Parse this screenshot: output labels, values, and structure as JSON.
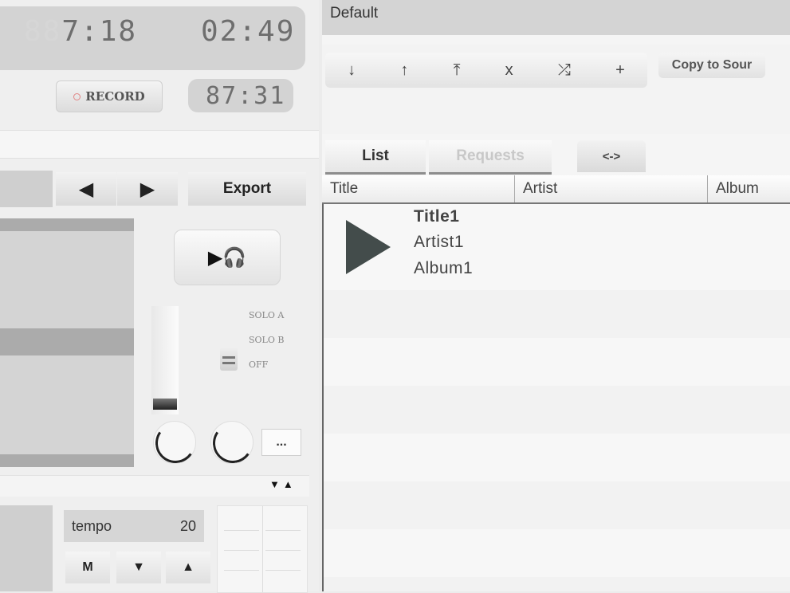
{
  "transport": {
    "elapsed_ghost": "88",
    "elapsed": "7:18",
    "remaining": "02:49",
    "record_label": "RECORD",
    "counter": "87:31"
  },
  "navigation": {
    "prev_icon": "◀",
    "next_icon": "▶",
    "export_label": "Export"
  },
  "preview": {
    "label": "▶🎧"
  },
  "solo": {
    "solo_a": "SOLO A",
    "solo_b": "SOLO B",
    "off": "OFF"
  },
  "more_label": "...",
  "sort_arrows": "▼▲",
  "tempo": {
    "label": "tempo",
    "value": "20",
    "m_label": "M",
    "down_icon": "▼",
    "up_icon": "▲"
  },
  "playlist": {
    "name": "Default",
    "toolbar_icons": [
      "↓",
      "↑",
      "⤒",
      "x",
      "⤮",
      "+"
    ],
    "copy_label": "Copy to Sour",
    "tabs": {
      "list": "List",
      "requests": "Requests",
      "swap": "<->"
    },
    "columns": {
      "title": "Title",
      "artist": "Artist",
      "album": "Album"
    },
    "tracks": [
      {
        "title": "Title1",
        "artist": "Artist1",
        "album": "Album1"
      }
    ]
  }
}
